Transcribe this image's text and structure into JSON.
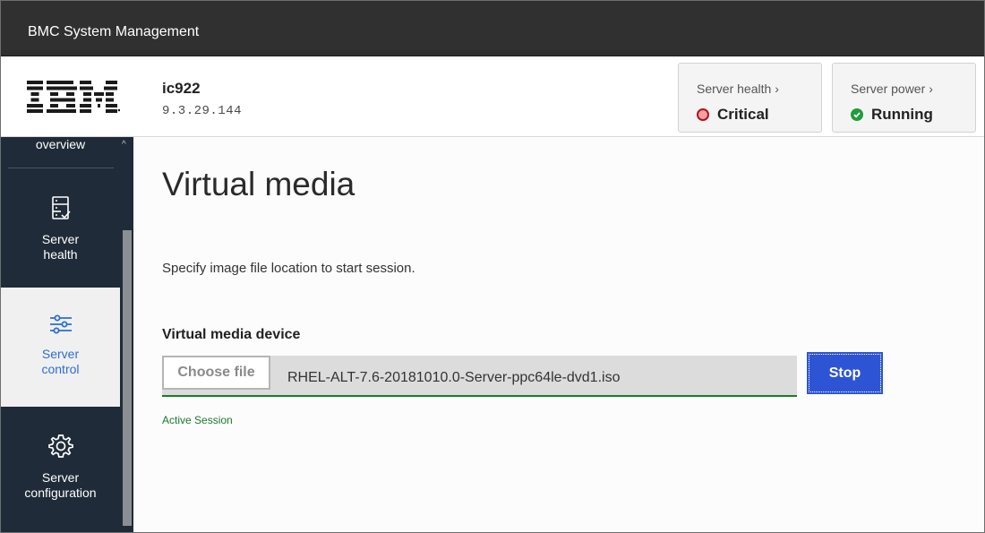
{
  "app": {
    "title": "BMC System Management"
  },
  "brand": {
    "logo": "IBM"
  },
  "server": {
    "name": "ic922",
    "ip": "9.3.29.144"
  },
  "status": {
    "health": {
      "label": "Server health",
      "value": "Critical",
      "icon": "critical-circle-icon",
      "color": "#b3121e"
    },
    "power": {
      "label": "Server power",
      "value": "Running",
      "icon": "check-circle-icon",
      "color": "#1f9d3a"
    }
  },
  "sidebar": {
    "items": [
      {
        "label": "overview"
      },
      {
        "label_line1": "Server",
        "label_line2": "health",
        "icon": "server-health-icon"
      },
      {
        "label_line1": "Server",
        "label_line2": "control",
        "icon": "sliders-icon",
        "active": true
      },
      {
        "label_line1": "Server",
        "label_line2": "configuration",
        "icon": "gear-icon"
      }
    ]
  },
  "main": {
    "title": "Virtual media",
    "description": "Specify image file location to start session.",
    "device_label": "Virtual media device",
    "choose_file_label": "Choose file",
    "file_name": "RHEL-ALT-7.6-20181010.0-Server-ppc64le-dvd1.iso",
    "stop_label": "Stop",
    "session_status": "Active Session"
  },
  "colors": {
    "accent": "#2e54d6",
    "success": "#1a7a2c",
    "sidebar": "#1f2b38",
    "topbar": "#303030"
  }
}
